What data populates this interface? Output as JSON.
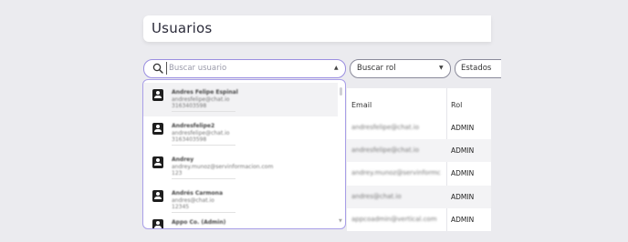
{
  "page": {
    "title": "Usuarios"
  },
  "filters": {
    "search_placeholder": "Buscar usuario",
    "role_label": "Buscar rol",
    "status_label": "Estados"
  },
  "table": {
    "headers": {
      "email": "Email",
      "role": "Rol"
    },
    "rows": [
      {
        "email": "andresfelipe@chat.io",
        "role": "ADMIN"
      },
      {
        "email": "andresfelipe@chat.io",
        "role": "ADMIN"
      },
      {
        "email": "andrey.munoz@servinformc",
        "role": "ADMIN"
      },
      {
        "email": "andres@chat.io",
        "role": "ADMIN"
      },
      {
        "email": "appcoadmin@vertical.com",
        "role": "ADMIN"
      }
    ]
  },
  "dropdown": {
    "items": [
      {
        "name": "Andres Felipe Espinal",
        "email": "andresfelipe@chat.io",
        "phone": "3163403598"
      },
      {
        "name": "Andresfelipe2",
        "email": "andresfelipe@chat.io",
        "phone": "3163403598"
      },
      {
        "name": "Andrey",
        "email": "andrey.munoz@servinformacion.com",
        "phone": "123"
      },
      {
        "name": "Andrés Carmona",
        "email": "andres@chat.io",
        "phone": "12345"
      },
      {
        "name": "Appo Co. (Admin)",
        "email": "",
        "phone": ""
      }
    ]
  },
  "colors": {
    "accent": "#9a8ee0",
    "background": "#ebebef"
  },
  "icons": {
    "search": "search-icon",
    "avatar": "user-avatar-icon"
  }
}
